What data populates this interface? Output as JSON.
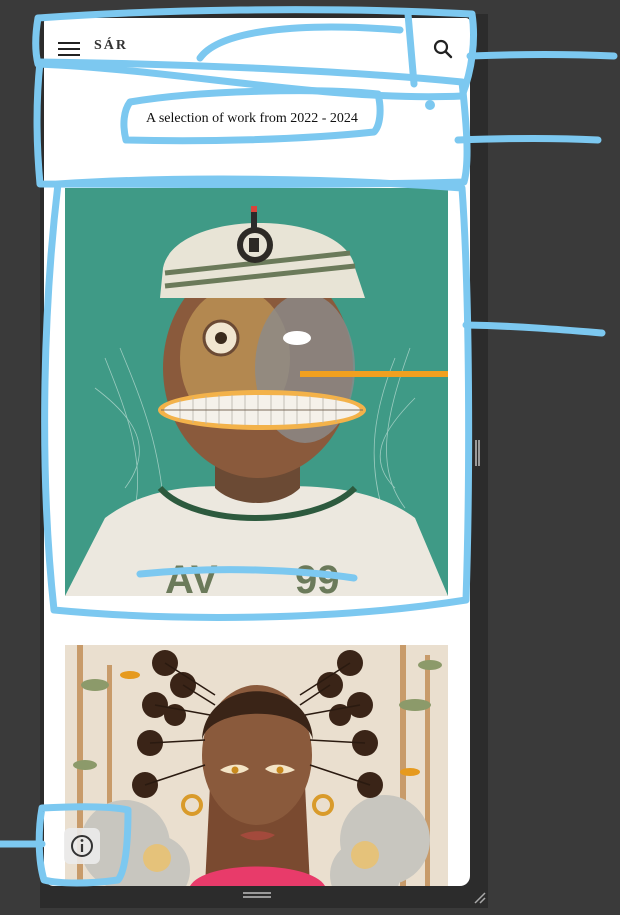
{
  "header": {
    "brand": "SÁR",
    "menu_icon": "hamburger-menu-icon",
    "search_icon": "search-icon"
  },
  "intro": {
    "tagline": "A selection of work from 2022 - 2024"
  },
  "gallery": {
    "items": [
      {
        "subject": "illustrated portrait, man in striped cap with robotic face and grinning teeth",
        "bg_color": "#3f9a86"
      },
      {
        "subject": "illustrated portrait, woman with braided hair buns among flowers",
        "bg_color": "#eadfcf"
      }
    ]
  },
  "footer": {
    "info_icon": "info-icon"
  },
  "colors": {
    "annotation": "#7cc8f0",
    "page_bg": "#3a3a3a",
    "card_bg": "#ffffff"
  }
}
